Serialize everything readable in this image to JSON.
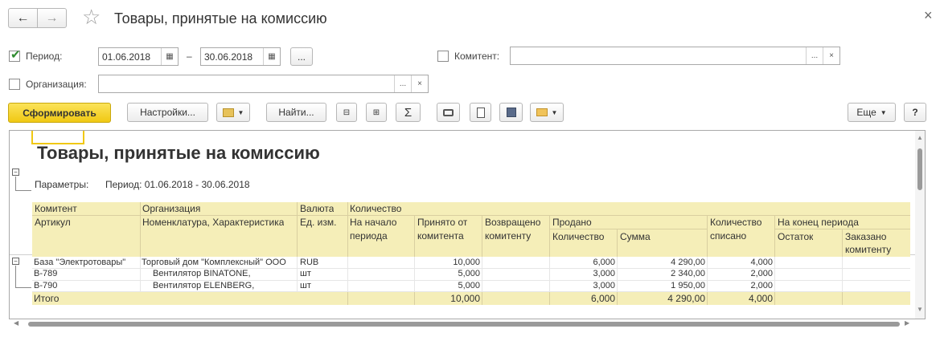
{
  "window": {
    "title": "Товары, принятые на комиссию",
    "nav_back": "←",
    "nav_forward": "→",
    "star": "☆",
    "close": "×"
  },
  "filters": {
    "period_label": "Период:",
    "period_checked": true,
    "date_from": "01.06.2018",
    "date_dash": "–",
    "date_to": "30.06.2018",
    "period_more": "...",
    "kommitent_label": "Комитент:",
    "kommitent_value": "",
    "kommitent_more": "...",
    "kommitent_clear": "×",
    "org_label": "Организация:",
    "org_value": "",
    "org_more": "...",
    "org_clear": "×"
  },
  "toolbar": {
    "generate": "Сформировать",
    "settings": "Настройки...",
    "find": "Найти...",
    "more": "Еще",
    "help": "?",
    "sigma": "Σ"
  },
  "report": {
    "title": "Товары, принятые на комиссию",
    "params_label": "Параметры:",
    "params_value": "Период: 01.06.2018 - 30.06.2018",
    "headers": {
      "kommitent": "Комитент",
      "artikul": "Артикул",
      "organizaciya": "Организация",
      "nomenklatura": "Номенклатура, Характеристика",
      "valyuta": "Валюта",
      "ed_izm": "Ед. изм.",
      "kolichestvo": "Количество",
      "na_nachalo_1": "На начало",
      "na_nachalo_2": "периода",
      "prinyato_1": "Принято от",
      "prinyato_2": "комитента",
      "vozvrascheno_1": "Возвращено",
      "vozvrascheno_2": "комитенту",
      "prodano": "Продано",
      "prodano_kol": "Количество",
      "prodano_summa": "Сумма",
      "spisano_1": "Количество",
      "spisano_2": "списано",
      "na_konec": "На конец периода",
      "ostatok": "Остаток",
      "zakazano_1": "Заказано",
      "zakazano_2": "комитенту"
    },
    "rows": [
      {
        "c1": "База \"Электротовары\"",
        "c2": "Торговый дом \"Комплексный\" ООО",
        "c3": "RUB",
        "c4": "",
        "c5": "10,000",
        "c6": "",
        "c7": "6,000",
        "c8": "4 290,00",
        "c9": "4,000",
        "c10": "",
        "c11": ""
      },
      {
        "c1": "В-789",
        "c2": "Вентилятор BINATONE,",
        "c3": "шт",
        "c4": "",
        "c5": "5,000",
        "c6": "",
        "c7": "3,000",
        "c8": "2 340,00",
        "c9": "2,000",
        "c10": "",
        "c11": ""
      },
      {
        "c1": "В-790",
        "c2": "Вентилятор ELENBERG,",
        "c3": "шт",
        "c4": "",
        "c5": "5,000",
        "c6": "",
        "c7": "3,000",
        "c8": "1 950,00",
        "c9": "2,000",
        "c10": "",
        "c11": ""
      }
    ],
    "total": {
      "label": "Итого",
      "c5": "10,000",
      "c7": "6,000",
      "c8": "4 290,00",
      "c9": "4,000"
    }
  },
  "colors": {
    "accent_button": "#f5d22a",
    "header_fill": "#f5eeb8",
    "checkbox_check": "#2e8b2e"
  }
}
